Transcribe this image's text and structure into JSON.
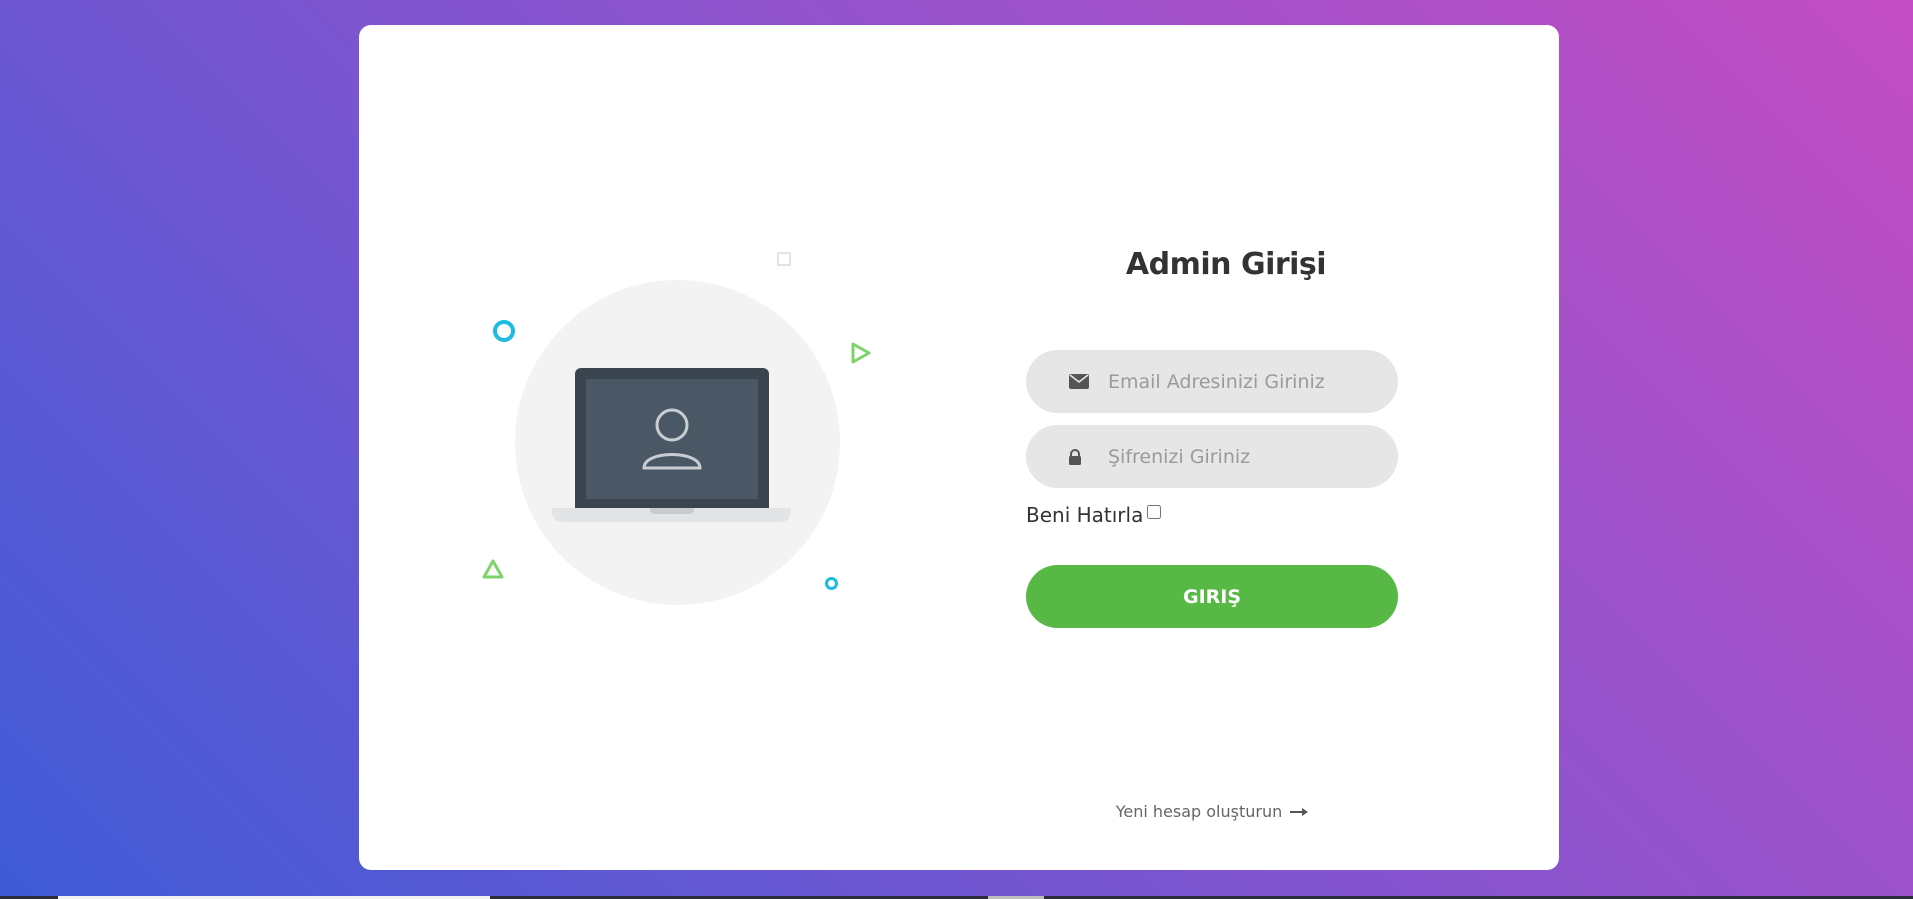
{
  "login": {
    "title": "Admin Girişi",
    "email_placeholder": "Email Adresinizi Giriniz",
    "password_placeholder": "Şifrenizi Giriniz",
    "remember_label": "Beni Hatırla",
    "remember_checked": false,
    "submit_label": "GIRIŞ",
    "signup_link": "Yeni hesap oluşturun"
  },
  "icons": {
    "email": "envelope-icon",
    "password": "lock-icon",
    "signup_arrow": "arrow-right-icon",
    "illustration": "laptop-user-icon"
  },
  "colors": {
    "background_start": "#3f5bd6",
    "background_end": "#c44dc3",
    "button": "#57b846",
    "accent_cyan": "#1bbbe3",
    "accent_green": "#7ed36a"
  }
}
